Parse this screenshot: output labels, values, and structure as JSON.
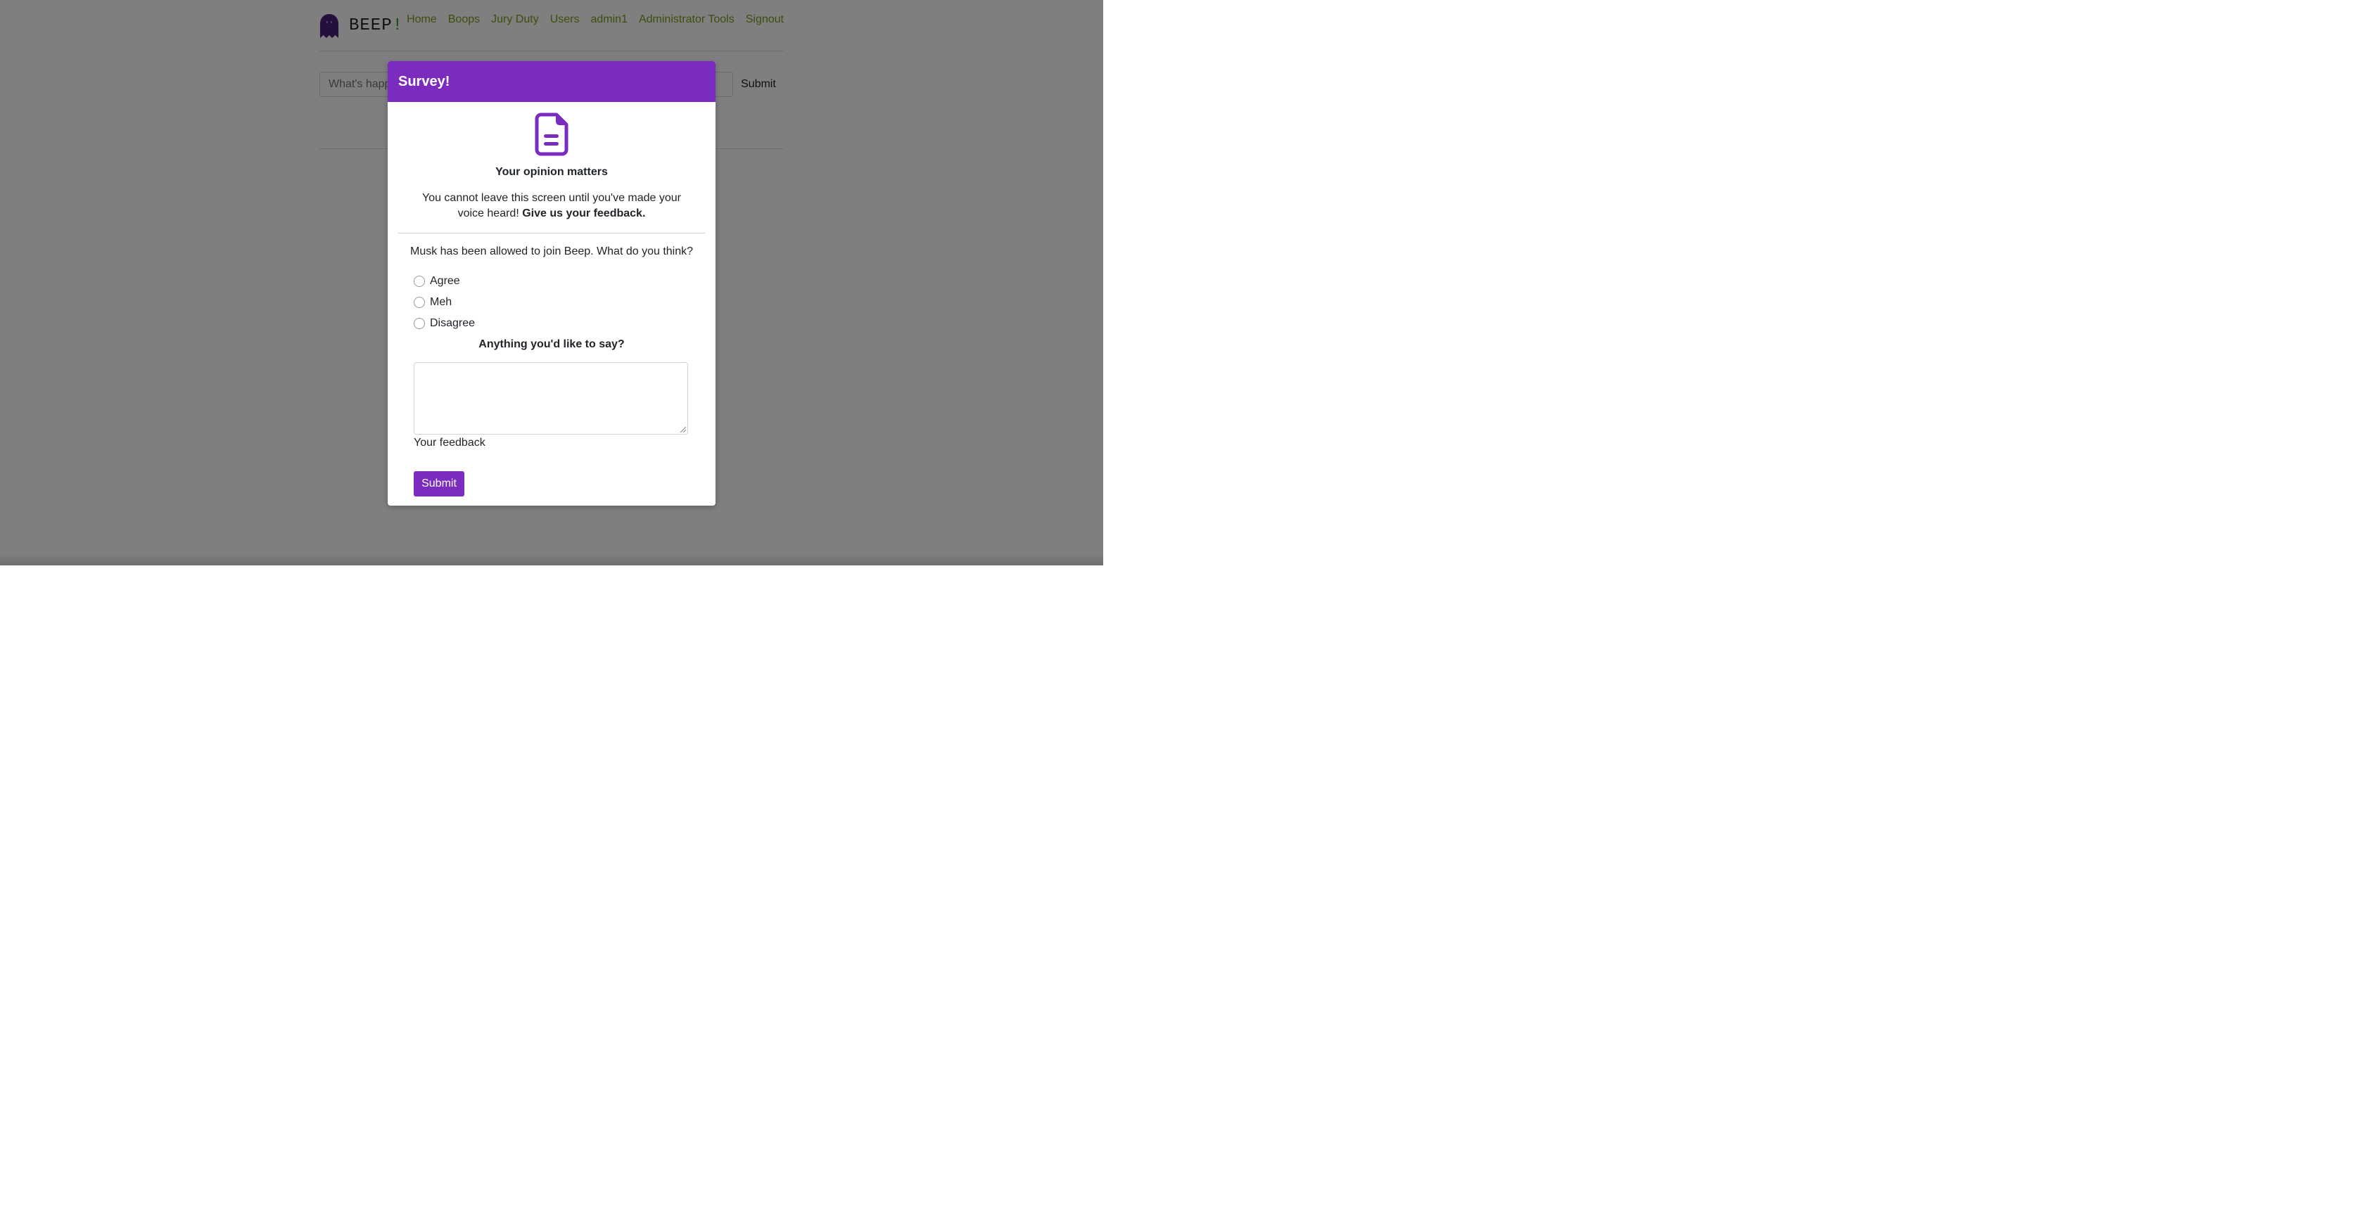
{
  "app": {
    "brand": "BEEP",
    "brand_suffix": "!"
  },
  "nav": {
    "items": [
      "Home",
      "Boops",
      "Jury Duty",
      "Users",
      "admin1",
      "Administrator Tools",
      "Signout"
    ]
  },
  "compose": {
    "placeholder": "What's happening?",
    "submit_label": "Submit"
  },
  "modal": {
    "title": "Survey!",
    "icon": "document-icon",
    "heading": "Your opinion matters",
    "intro_text": "You cannot leave this screen until you've made your voice heard! ",
    "intro_bold": "Give us your feedback.",
    "question": "Musk has been allowed to join Beep. What do you think?",
    "options": [
      "Agree",
      "Meh",
      "Disagree"
    ],
    "comment_heading": "Anything you'd like to say?",
    "feedback_value": "",
    "feedback_label": "Your feedback",
    "submit_label": "Submit"
  },
  "colors": {
    "accent": "#7b2cbf",
    "nav_link": "#7a9a1c",
    "overlay": "rgba(0,0,0,0.5)"
  }
}
